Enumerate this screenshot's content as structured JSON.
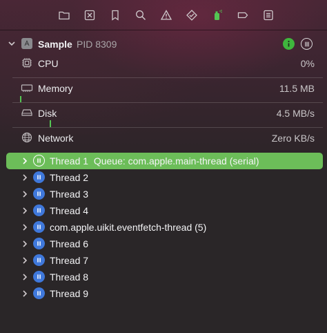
{
  "toolbar": {
    "icons": [
      "folder-icon",
      "xmark-square-icon",
      "bookmark-icon",
      "magnifier-icon",
      "warning-icon",
      "diamond-icon",
      "spray-can-icon",
      "tag-icon",
      "list-icon"
    ]
  },
  "process": {
    "name": "Sample",
    "pid": "PID 8309"
  },
  "gauges": [
    {
      "label": "CPU",
      "value": "0%"
    },
    {
      "label": "Memory",
      "value": "11.5 MB"
    },
    {
      "label": "Disk",
      "value": "4.5 MB/s"
    },
    {
      "label": "Network",
      "value": "Zero KB/s"
    }
  ],
  "threads": [
    {
      "name": "Thread 1",
      "queue": "Queue: com.apple.main-thread (serial)",
      "selected": true
    },
    {
      "name": "Thread 2",
      "queue": ""
    },
    {
      "name": "Thread 3",
      "queue": ""
    },
    {
      "name": "Thread 4",
      "queue": ""
    },
    {
      "name": "com.apple.uikit.eventfetch-thread (5)",
      "queue": ""
    },
    {
      "name": "Thread 6",
      "queue": ""
    },
    {
      "name": "Thread 7",
      "queue": ""
    },
    {
      "name": "Thread 8",
      "queue": ""
    },
    {
      "name": "Thread 9",
      "queue": ""
    }
  ],
  "colors": {
    "accent_green": "#6cbd59",
    "thread_blue": "#3f78db",
    "activity_green": "#54c653"
  }
}
